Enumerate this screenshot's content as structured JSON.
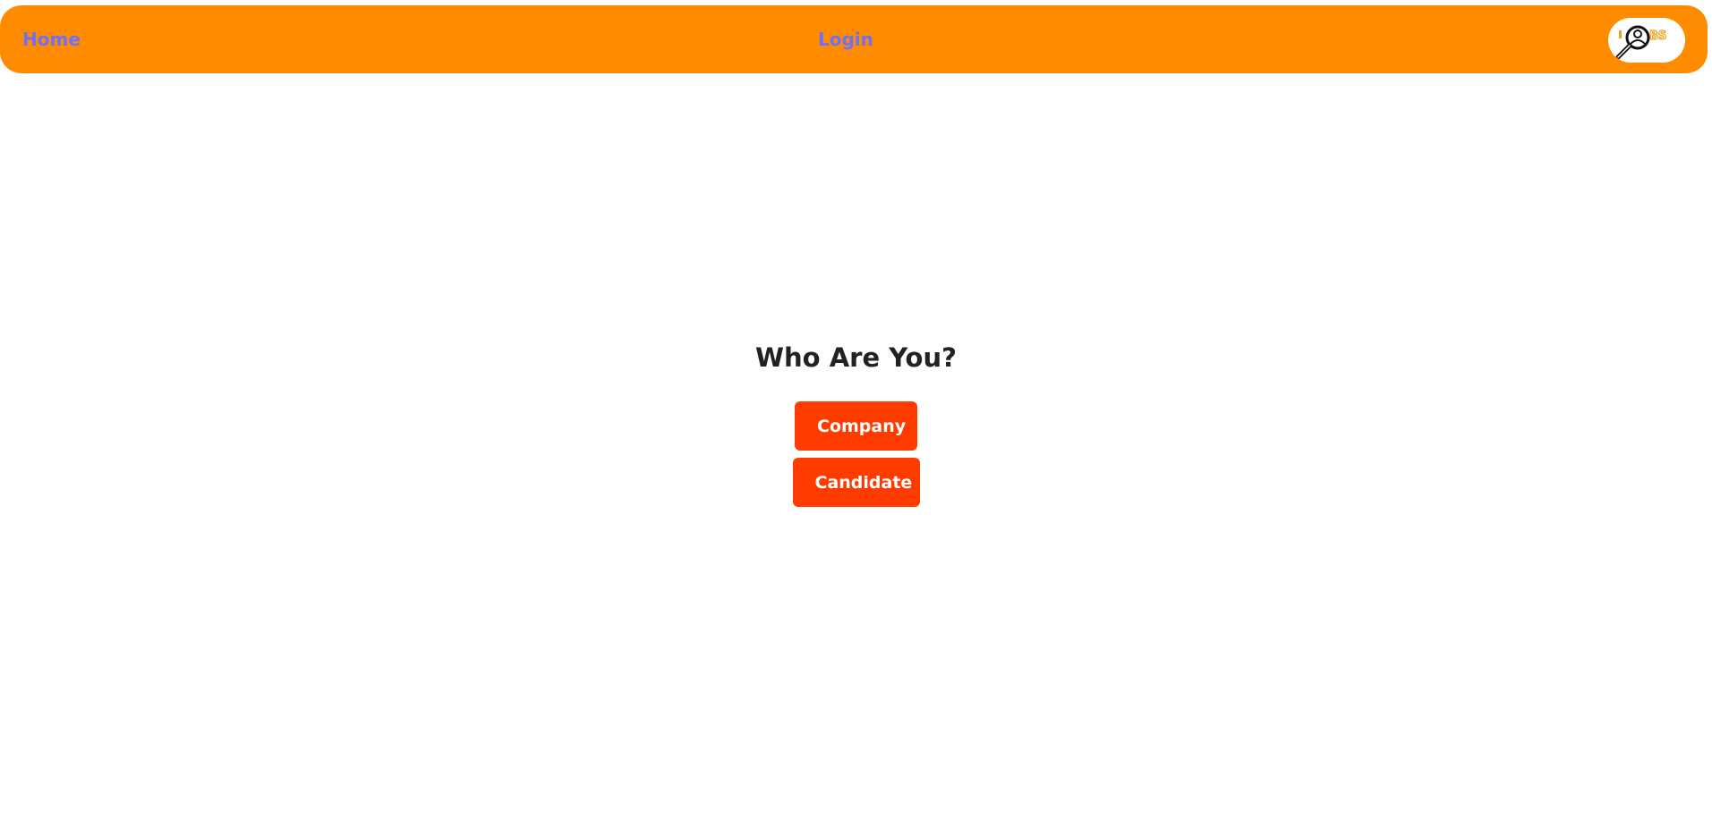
{
  "nav": {
    "home_label": "Home",
    "login_label": "Login"
  },
  "logo": {
    "icon": "magnifier-person-icon",
    "text": "JOBS"
  },
  "main": {
    "title": "Who Are You?",
    "company_label": "Company",
    "candidate_label": "Candidate"
  },
  "colors": {
    "navbar": "#ff8c00",
    "nav_link": "#6f6ff7",
    "button": "#ff3b00",
    "title": "#222222"
  }
}
